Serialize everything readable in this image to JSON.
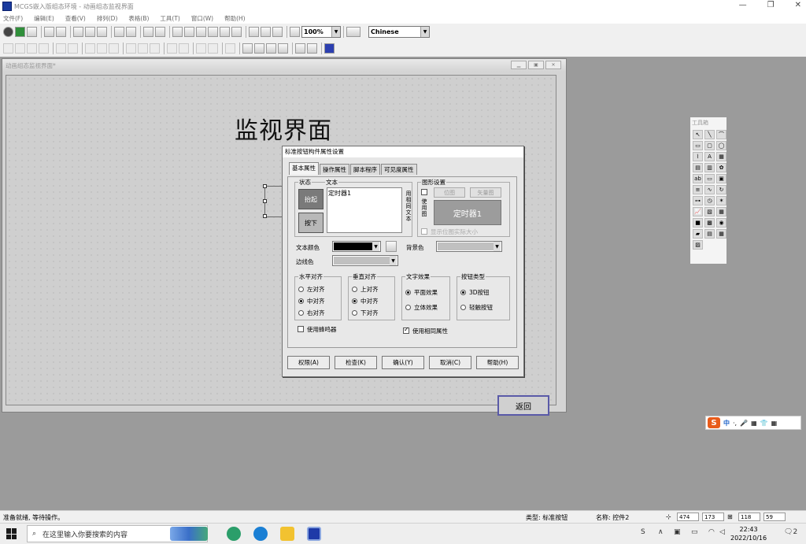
{
  "window": {
    "title": "MCGS嵌入版组态环境 - 动画组态监视界面"
  },
  "menu": [
    "文件(F)",
    "编辑(E)",
    "查看(V)",
    "排列(D)",
    "表格(B)",
    "工具(T)",
    "窗口(W)",
    "帮助(H)"
  ],
  "toolbar": {
    "zoom": "100%",
    "language": "Chinese"
  },
  "mdi": {
    "title": "动画组态监视界面*"
  },
  "canvas": {
    "heading": "监视界面",
    "back_button": "返回"
  },
  "dialog": {
    "title": "标准按钮构件属性设置",
    "tabs": [
      "基本属性",
      "操作属性",
      "脚本程序",
      "可见度属性"
    ],
    "state_group": "状态",
    "text_group": "文本",
    "state_up": "抬起",
    "state_down": "按下",
    "text_value": "定时器1",
    "same_text": "用相同文本",
    "image_group": "图形设置",
    "use_image": "使用图",
    "bitmap_button": "位图",
    "vector_button": "矢量图",
    "preview_text": "定时器1",
    "show_real_size": "显示位图实际大小",
    "text_color_label": "文本颜色",
    "bg_color_label": "背景色",
    "border_color_label": "边线色",
    "text_color": "#000000",
    "bg_color": "#c0c0c0",
    "border_color": "#c0c0c0",
    "halign": {
      "label": "水平对齐",
      "options": [
        "左对齐",
        "中对齐",
        "右对齐"
      ],
      "selected": 1
    },
    "valign": {
      "label": "垂直对齐",
      "options": [
        "上对齐",
        "中对齐",
        "下对齐"
      ],
      "selected": 1
    },
    "effect": {
      "label": "文字效果",
      "options": [
        "平面效果",
        "立体效果"
      ],
      "selected": 0
    },
    "btype": {
      "label": "按钮类型",
      "options": [
        "3D按钮",
        "轻触按钮"
      ],
      "selected": 0
    },
    "use_buzzer": "使用蜂鸣器",
    "use_same_props": "使用相同属性",
    "buttons": [
      "权限(A)",
      "检查(K)",
      "确认(Y)",
      "取消(C)",
      "帮助(H)"
    ]
  },
  "toolbox": {
    "title": "工具箱"
  },
  "ime": {
    "logo": "S",
    "lang": "中"
  },
  "status": {
    "left": "准备就绪, 等待操作。",
    "type": "类型: 标准按钮",
    "name": "名称: 控件2",
    "x": "474",
    "y": "173",
    "w": "118",
    "h": "59"
  },
  "taskbar": {
    "search_placeholder": "在这里输入你要搜索的内容",
    "time": "22:43",
    "date": "2022/10/16",
    "notif": "2"
  }
}
